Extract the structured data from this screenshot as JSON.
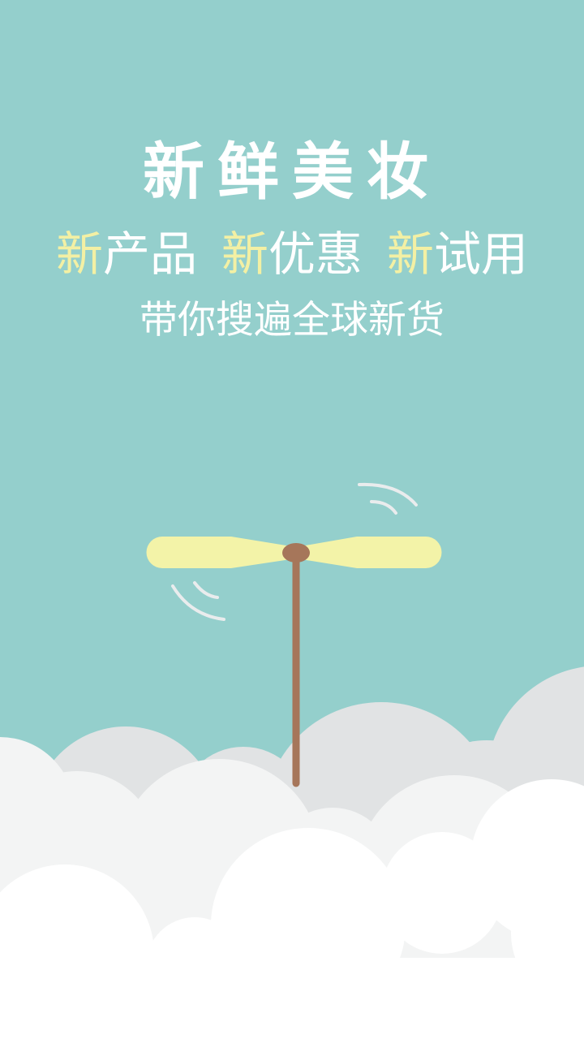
{
  "splash": {
    "title": "新鲜美妆",
    "features": [
      {
        "highlight": "新",
        "rest": "产品"
      },
      {
        "highlight": "新",
        "rest": "优惠"
      },
      {
        "highlight": "新",
        "rest": "试用"
      }
    ],
    "subtitle": "带你搜遍全球新货"
  },
  "colors": {
    "background": "#94cfcc",
    "highlight": "#f3f0a4",
    "text": "#ffffff",
    "propeller_blade": "#f3f3a8",
    "propeller_stick": "#a6765a",
    "cloud_back": "#e1e3e4",
    "cloud_mid": "#f3f4f4",
    "cloud_front": "#ffffff"
  },
  "icons": [
    "bamboo-copter-icon",
    "motion-lines-icon",
    "cloud-illustration"
  ]
}
